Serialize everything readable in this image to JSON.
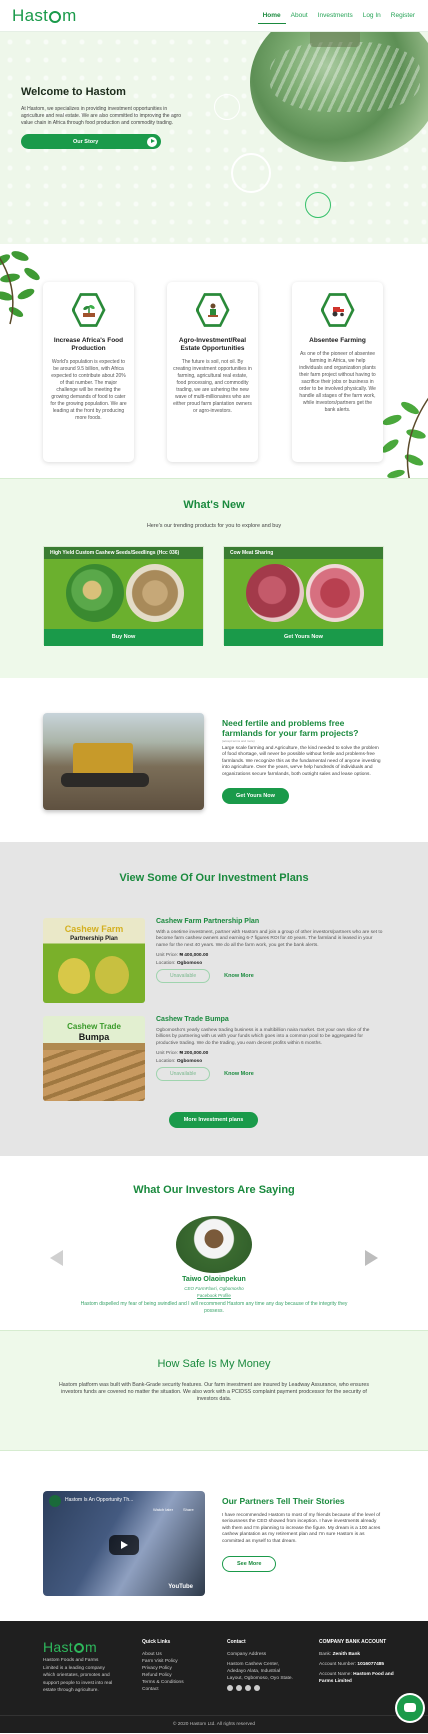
{
  "brand": {
    "name_left": "Hast",
    "name_right": "m"
  },
  "nav": {
    "items": [
      "Home",
      "About",
      "Investments",
      "Log In",
      "Register"
    ]
  },
  "hero": {
    "title": "Welcome to Hastom",
    "text": "At Hastom, we specializes in providing investment opportunities in agriculture and real estate. We are also committed to improving the agro value chain in Africa through food production and commodity trading.",
    "button": "Our Story"
  },
  "features": [
    {
      "icon": "plant-icon",
      "title": "Increase Africa's Food Production",
      "text": "World's population is expected to be around 9.5 billion, with Africa expected to contribute about 20% of that number. The major challenge will be meeting the growing demands of food to cater for the growing population. We are leading at the front by producing more foods."
    },
    {
      "icon": "farmer-icon",
      "title": "Agro-Investment/Real Estate Opportunities",
      "text": "The future is soil, not oil. By creating investment opportunities in farming, agricultural real estate, food processing, and commodity trading, we are ushering the new wave of multi-millionaires who are either proud farm plantation owners or agro-investors."
    },
    {
      "icon": "tractor-icon",
      "title": "Absentee Farming",
      "text": "As one of the pioneer of absentee farming in Africa, we help individuals and organization plants their farm project without having to sacrifice their jobs or business in order to be involved physically. We handle all stages of the farm work, while investors/partners get the bank alerts."
    }
  ],
  "whats_new": {
    "title": "What's New",
    "subtitle": "Here's our trending products for you to explore and buy",
    "products": [
      {
        "name": "High Yield Custom Cashew Seeds/Seedlings (Hcc 036)",
        "button": "Buy Now"
      },
      {
        "name": "Cow Meat Sharing",
        "button": "Get Yours Now"
      }
    ]
  },
  "fertile": {
    "title": "Need fertile and problems free farmlands for your farm projects?",
    "note": "(accept terms and more)",
    "text": "Large scale farming and Agriculture, the kind needed to solve the problem of food shortage, will never be possible without fertile and problems-free farmlands. We recognize this as the fundamental need of anyone investing into agriculture. Over the years, we've help hundreds of individuals and organizations secure farmlands, both outright sales and lease options.",
    "button": "Get Yours Now"
  },
  "plans": {
    "title": "View Some Of Our Investment Plans",
    "items": [
      {
        "img_title_1": "Cashew Farm",
        "img_title_2": "Partnership Plan",
        "name": "Cashew Farm Partnership Plan",
        "text": "With a onetime investment, partner with Hastom and join a group of other investors/partners who are set to become farm cashew owners and earning 6-7 figures ROI for 40 years. The farmland is leased in your name for the next 40 years. We do all the farm work, you get the bank alerts.",
        "price_label": "Unit Price:",
        "price": "₦ 400,000.00",
        "loc_label": "Location:",
        "location": "Ogbomoso",
        "status": "Unavailable",
        "more": "Know More"
      },
      {
        "img_title_1": "Cashew Trade",
        "img_title_2": "Bumpa",
        "name": "Cashew Trade Bumpa",
        "text": "Ogbomosho's yearly cashew trading business is a multibillion naira market. Get your own slice of the billions by partnering with us with your funds which goes into a common pool to be aggregated for productive trading. We do the trading, you earn decent profits within 6 months.",
        "price_label": "Unit Price:",
        "price": "₦ 200,000.00",
        "loc_label": "Location:",
        "location": "Ogbomoso",
        "status": "Unavailable",
        "more": "Know More"
      }
    ],
    "button": "More Investment plans"
  },
  "testimonials": {
    "title": "What Our Investors Are Saying",
    "name": "Taiwo Olaoinpekun",
    "role": "CEO FarmFlavri, Ogbomosho",
    "link": "Facebook Profile",
    "quote": "Hastom dispelled my fear of being swindled and I will recommend Hastom any time any day because of the integrity they possess."
  },
  "safe": {
    "title": "How Safe Is My Money",
    "text": "Hastom platform was built with Bank-Grade security features. Our farm investment are insured by Leadway Assurance, who ensures investors funds are covered no matter the situation. We also work with a PCIDSS complaint payment prodcessor for the security of investors data."
  },
  "partners": {
    "title": "Our Partners Tell Their Stories",
    "video_title": "Hastom Is An Opportunity Th...",
    "video_watch": "Watch later",
    "video_share": "Share",
    "video_brand": "YouTube",
    "text": "I have recommended Hastom to most of my friends because of the level of seriousness the CEO showed from inception. I have investments already with them and I'm planning to increase the figure. My dream is a 100 acres cashew plantation as my retirement plan and I'm sure Hastom is as committed as myself to that dream.",
    "button": "See More"
  },
  "footer": {
    "about": "Hastom Foods and Farms Limited is a leading company which orientates, promotes and support people to invest into real estate through agriculture.",
    "quick_title": "Quick Links",
    "quick_links": [
      "About Us",
      "Farm Visit Policy",
      "Privacy Policy",
      "Refund Policy",
      "Terms & Conditions",
      "Contact"
    ],
    "contact_title": "Contact",
    "contact_lines": [
      "Company Address",
      "Hastom Cashew Center, Adedayo Alata, Industrial Layout, Ogbomoso, Oyo State."
    ],
    "bank_title": "COMPANY BANK ACCOUNT",
    "bank_label": "Bank:",
    "bank": "Zenith Bank",
    "acct_label": "Account Number:",
    "acct": "1016077485",
    "name_label": "Account Name:",
    "acct_name": "Hastom Food and Farms Limited",
    "copyright": "© 2020 Hastom Ltd. All rights reserved"
  },
  "colors": {
    "brand": "#1a9a4a",
    "accent_dark": "#1a8a3e",
    "tint": "#eef9ea",
    "footer": "#1f1f1f"
  }
}
